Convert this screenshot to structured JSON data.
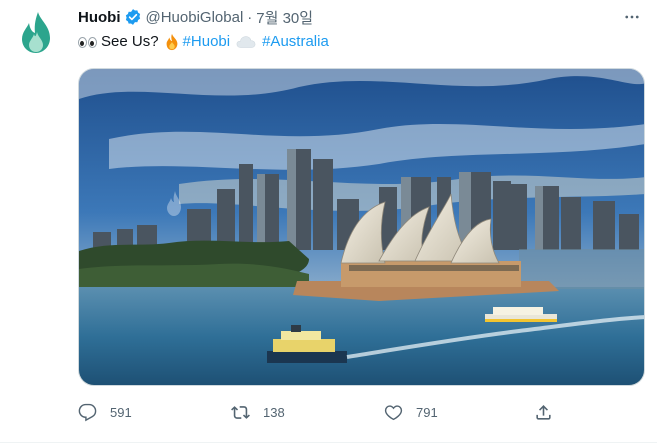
{
  "tweet": {
    "display_name": "Huobi",
    "handle": "@HuobiGlobal",
    "separator": "·",
    "date": "7월 30일",
    "text_see_us": "See Us?",
    "hashtag_huobi": "#Huobi",
    "hashtag_australia": "#Australia"
  },
  "actions": {
    "replies": "591",
    "retweets": "138",
    "likes": "791"
  },
  "icons": {
    "avatar": "huobi-flame-logo",
    "verified": "verified-badge-icon",
    "more": "more-dots-icon",
    "reply": "reply-icon",
    "retweet": "retweet-icon",
    "like": "heart-icon",
    "share": "share-icon",
    "emoji_eyes": "eyes-emoji",
    "emoji_fire": "fire-emoji",
    "emoji_cloud": "cloud-emoji"
  },
  "colors": {
    "accent": "#1d9bf0",
    "brand_green": "#2ca58d",
    "text_primary": "#0f1419",
    "text_secondary": "#536471"
  }
}
